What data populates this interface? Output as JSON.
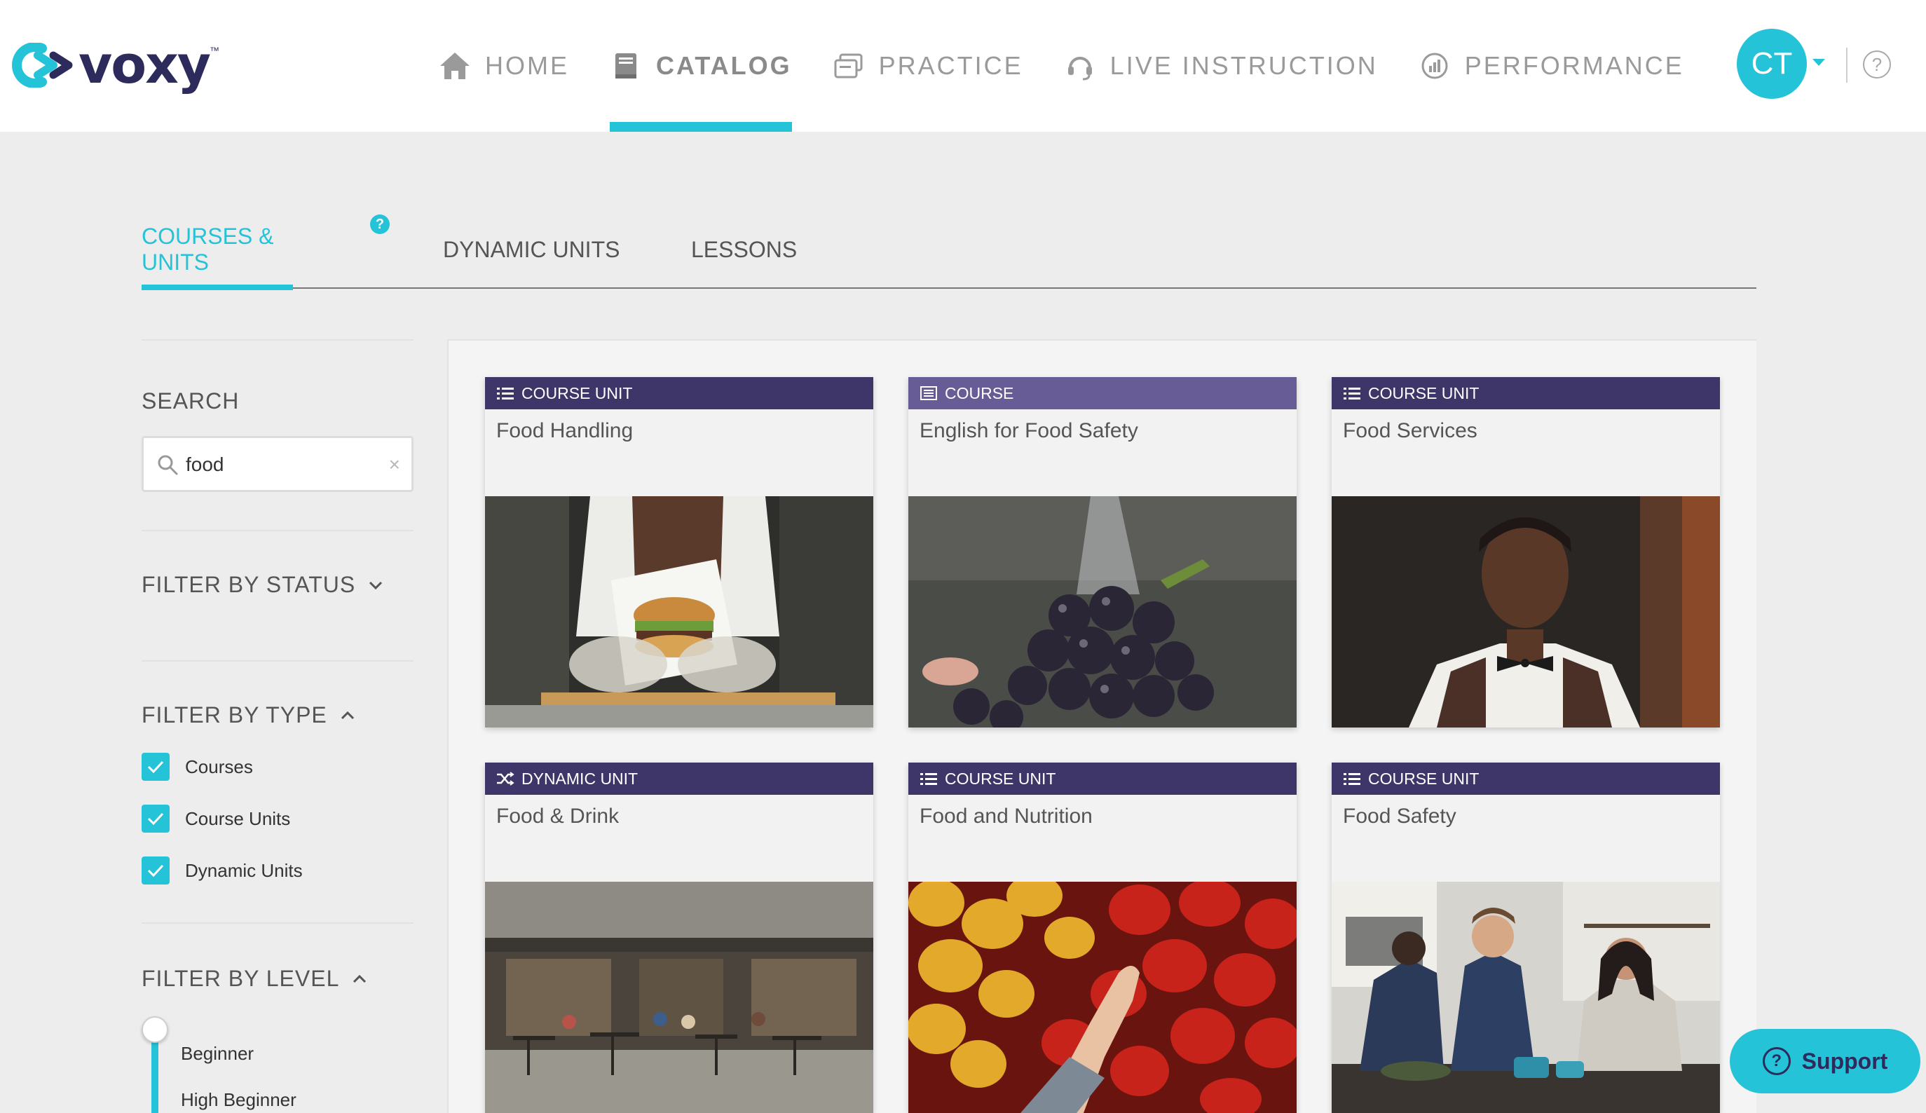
{
  "brand": {
    "name": "voxy",
    "tm": "™",
    "accent": "#25c3d8",
    "navy": "#2d2a5c"
  },
  "nav": [
    {
      "label": "HOME",
      "icon": "home-icon",
      "active": false
    },
    {
      "label": "CATALOG",
      "icon": "book-icon",
      "active": true
    },
    {
      "label": "PRACTICE",
      "icon": "practice-icon",
      "active": false
    },
    {
      "label": "LIVE INSTRUCTION",
      "icon": "headset-icon",
      "active": false
    },
    {
      "label": "PERFORMANCE",
      "icon": "chart-icon",
      "active": false
    }
  ],
  "user": {
    "initials": "CT"
  },
  "help": {
    "glyph": "?"
  },
  "tabs": [
    {
      "label": "COURSES & UNITS",
      "active": true,
      "badge": "?"
    },
    {
      "label": "DYNAMIC UNITS",
      "active": false
    },
    {
      "label": "LESSONS",
      "active": false
    }
  ],
  "sidebar": {
    "search_title": "SEARCH",
    "search_value": "food",
    "clear_glyph": "×",
    "filter_status": "FILTER BY STATUS",
    "filter_type": "FILTER BY TYPE",
    "type_options": [
      "Courses",
      "Course Units",
      "Dynamic Units"
    ],
    "filter_level": "FILTER BY LEVEL",
    "levels": [
      "Beginner",
      "High Beginner"
    ]
  },
  "cards": [
    {
      "type": "COURSE UNIT",
      "title": "Food Handling",
      "type_icon": "list-icon",
      "image": "burger-photo"
    },
    {
      "type": "COURSE",
      "title": "English for Food Safety",
      "type_icon": "course-icon",
      "image": "grapes-photo"
    },
    {
      "type": "COURSE UNIT",
      "title": "Food Services",
      "type_icon": "list-icon",
      "image": "server-photo"
    },
    {
      "type": "DYNAMIC UNIT",
      "title": "Food & Drink",
      "type_icon": "shuffle-icon",
      "image": "cafe-photo"
    },
    {
      "type": "COURSE UNIT",
      "title": "Food and Nutrition",
      "type_icon": "list-icon",
      "image": "peppers-photo"
    },
    {
      "type": "COURSE UNIT",
      "title": "Food Safety",
      "type_icon": "list-icon",
      "image": "kitchen-photo"
    }
  ],
  "support": {
    "label": "Support",
    "glyph": "?"
  }
}
